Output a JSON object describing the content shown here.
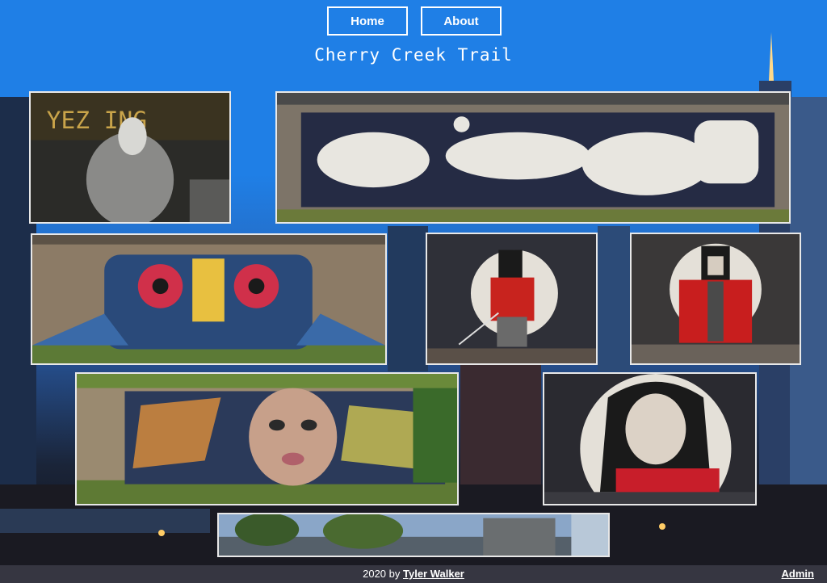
{
  "nav": {
    "home_label": "Home",
    "about_label": "About"
  },
  "page": {
    "title": "Cherry Creek Trail"
  },
  "gallery": {
    "photos": [
      {
        "name": "mural-yezing-photo"
      },
      {
        "name": "mural-white-figures-photo"
      },
      {
        "name": "mural-dizcruz-photo"
      },
      {
        "name": "mural-samurai-sword-photo"
      },
      {
        "name": "mural-red-kimono-photo"
      },
      {
        "name": "mural-girl-face-photo"
      },
      {
        "name": "mural-kimono-woman-photo"
      },
      {
        "name": "trail-park-photo"
      }
    ]
  },
  "footer": {
    "year_prefix": "2020 by",
    "author": "Tyler Walker",
    "admin_label": "Admin"
  },
  "colors": {
    "sky": "#1f7fe6",
    "frame": "#e8e8e8",
    "footer_bg": "#3c3c46"
  }
}
